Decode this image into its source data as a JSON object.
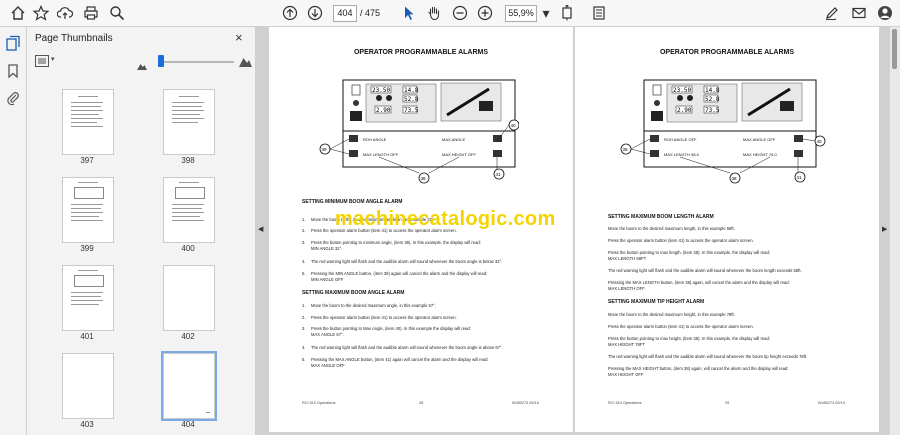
{
  "toolbar": {
    "current_page": "404",
    "page_separator": "/ 475",
    "zoom": "55,9%"
  },
  "thumbs_panel": {
    "title": "Page Thumbnails",
    "close": "×",
    "pages": [
      "397",
      "398",
      "399",
      "400",
      "401",
      "402",
      "403",
      "404"
    ],
    "selected": "404"
  },
  "left_page": {
    "title": "OPERATOR PROGRAMMABLE ALARMS",
    "diagram": {
      "display_values": [
        "23.50",
        "14.8",
        "52.8",
        "2.90",
        "73.5"
      ],
      "panel_labels": [
        "ROH ANGLE",
        "MAX ANGLE",
        "MAX LENGTH OFF",
        "MAX HEIGHT OFF"
      ],
      "callouts": [
        "39",
        "40",
        "38",
        "41"
      ]
    },
    "section1": "SETTING MINIMUM BOOM ANGLE ALARM",
    "s1_items": [
      {
        "n": "1.",
        "t": "Move the boom to the desired minimum angle, in this example 32°."
      },
      {
        "n": "2.",
        "t": "Press the operator alarm button (item 41) to access the operator alarm screen."
      },
      {
        "n": "3.",
        "t": "Press the button pointing to minimum angle, (item 39). In this example, the display will read:"
      },
      {
        "n": "",
        "t": "MIN ANGLE 32°."
      },
      {
        "n": "4.",
        "t": "The red warning light will flash and the audible alarm will sound whenever the boom angle is below 32°."
      },
      {
        "n": "5.",
        "t": "Pressing the MIN ANGLE button, (item 39) again will cancel the alarm and the display will read:"
      },
      {
        "n": "",
        "t": "MIN ANGLE OFF"
      }
    ],
    "section2": "SETTING MAXIMUM BOOM ANGLE ALARM",
    "s2_items": [
      {
        "n": "1.",
        "t": "Move the boom to the desired maximum angle, in this example 67°."
      },
      {
        "n": "2.",
        "t": "Press the operator alarm button (item 41) to access the operator alarm screen."
      },
      {
        "n": "3.",
        "t": "Press the button pointing to Max Angle, (item 40). In this example the display will read:"
      },
      {
        "n": "",
        "t": "MAX ANGLE 67°."
      },
      {
        "n": "4.",
        "t": "The red warning light will flash and the audible alarm will sound whenever the boom angle is above 67°."
      },
      {
        "n": "5.",
        "t": "Pressing the MAX ANGLE button, (item 41) again will cancel the alarm and the display will read:"
      },
      {
        "n": "",
        "t": "MAX ANGLE OFF"
      }
    ],
    "footer_left": "RCI 510 Operations",
    "footer_mid": "28",
    "footer_right": "W450273 09/10"
  },
  "right_page": {
    "title": "OPERATOR PROGRAMMABLE ALARMS",
    "diagram": {
      "display_values": [
        "23.50",
        "14.8",
        "52.8",
        "2.90",
        "73.5"
      ],
      "panel_labels": [
        "ROH ANGLE OFF",
        "MAX ANGLE OFF",
        "MAX LENGTH 58.0",
        "MAX HEIGHT 78.0"
      ],
      "callouts": [
        "39",
        "40",
        "38",
        "41"
      ]
    },
    "section1": "SETTING MAXIMUM BOOM LENGTH ALARM",
    "s1_items": [
      {
        "n": "",
        "t": "Move the boom to the desired maximum length, in this example 58ft."
      },
      {
        "n": "",
        "t": "Press the operator alarm button (item 41) to access the operator alarm screen."
      },
      {
        "n": "",
        "t": "Press the button pointing to max length, (item 38). In this example, the display will read:"
      },
      {
        "n": "",
        "t": "MAX LENGTH 58FT"
      },
      {
        "n": "",
        "t": "The red warning light will flash and the audible alarm will sound whenever the boom length exceeds 58ft."
      },
      {
        "n": "",
        "t": "Pressing the MAX LENGTH button, (item 38) again, will cancel the alarm and the display will read:"
      },
      {
        "n": "",
        "t": "MAX LENGTH OFF"
      }
    ],
    "section2": "SETTING MAXIMUM TIP HEIGHT ALARM",
    "s2_items": [
      {
        "n": "",
        "t": "Move the boom to the desired maximum height, in this example 78ft."
      },
      {
        "n": "",
        "t": "Press the operator alarm button (item 41) to access the operator alarm screen."
      },
      {
        "n": "",
        "t": "Press the button pointing to max height, (item 38). In this example, the display will read:"
      },
      {
        "n": "",
        "t": "MAX HEIGHT 78FT"
      },
      {
        "n": "",
        "t": "The red warning light will flash and the audible alarm will sound whenever the boom tip height exceeds 78ft."
      },
      {
        "n": "",
        "t": "Pressing the MAX HEIGHT button, (item 38) again, will cancel the alarm and the display will read:"
      },
      {
        "n": "",
        "t": "MAX HEIGHT OFF"
      }
    ],
    "footer_left": "RCI 510 Operations",
    "footer_mid": "29",
    "footer_right": "W450273 09/10"
  },
  "watermark": "machinecatalogic.com"
}
